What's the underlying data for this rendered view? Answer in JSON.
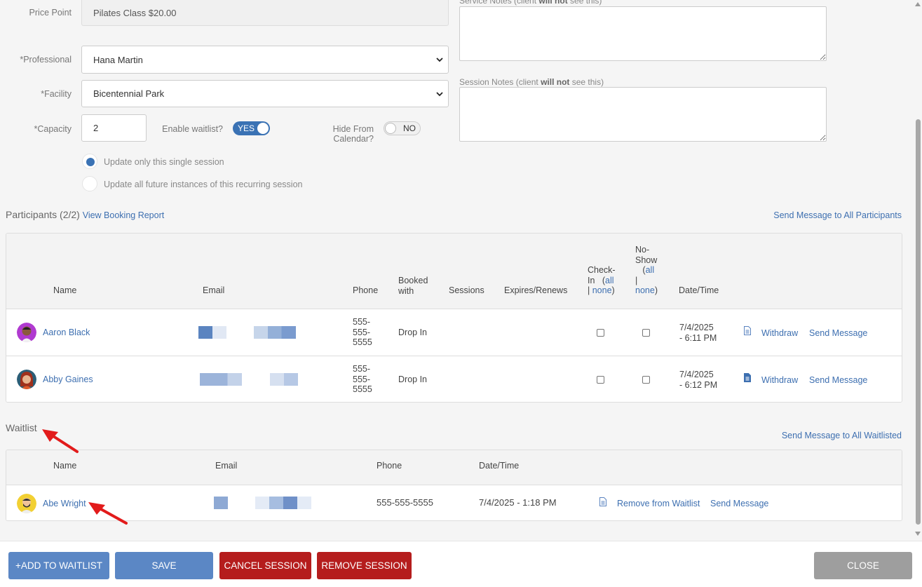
{
  "form": {
    "price_point_label": "Price Point",
    "price_point_value": "Pilates Class $20.00",
    "professional_label": "*Professional",
    "professional_value": "Hana Martin",
    "facility_label": "*Facility",
    "facility_value": "Bicentennial Park",
    "capacity_label": "*Capacity",
    "capacity_value": "2",
    "waitlist_label": "Enable waitlist?",
    "waitlist_toggle": "YES",
    "hide_label_1": "Hide From",
    "hide_label_2": "Calendar?",
    "hide_toggle": "NO",
    "radio_single": "Update only this single session",
    "radio_all": "Update all future instances of this recurring session",
    "service_notes_pre": "Service Notes (client ",
    "service_notes_bold": "will not",
    "service_notes_post": " see this)",
    "session_notes_pre": "Session Notes (client ",
    "session_notes_bold": "will not",
    "session_notes_post": " see this)"
  },
  "participants": {
    "title": "Participants (2/2)",
    "report_link": "View Booking Report",
    "send_all": "Send Message to All Participants",
    "headers": {
      "name": "Name",
      "email": "Email",
      "phone": "Phone",
      "booked_1": "Booked",
      "booked_2": "with",
      "sessions": "Sessions",
      "expires": "Expires/Renews",
      "checkin_1": "Check-",
      "checkin_2": "In",
      "noshow_1": "No-",
      "noshow_2": "Show",
      "all": "all",
      "sep": "|",
      "none": "none",
      "datetime": "Date/Time"
    },
    "rows": [
      {
        "name": "Aaron Black",
        "phone_1": "555-",
        "phone_2": "555-",
        "phone_3": "5555",
        "booked": "Drop In",
        "date_1": "7/4/2025",
        "date_2": "- 6:11 PM",
        "withdraw": "Withdraw",
        "send": "Send Message"
      },
      {
        "name": "Abby Gaines",
        "phone_1": "555-",
        "phone_2": "555-",
        "phone_3": "5555",
        "booked": "Drop In",
        "date_1": "7/4/2025",
        "date_2": "- 6:12 PM",
        "withdraw": "Withdraw",
        "send": "Send Message"
      }
    ]
  },
  "waitlist": {
    "title": "Waitlist",
    "send_all": "Send Message to All Waitlisted",
    "headers": {
      "name": "Name",
      "email": "Email",
      "phone": "Phone",
      "datetime": "Date/Time"
    },
    "rows": [
      {
        "name": "Abe Wright",
        "phone": "555-555-5555",
        "datetime": "7/4/2025 - 1:18 PM",
        "remove": "Remove from Waitlist",
        "send": "Send Message"
      }
    ]
  },
  "footer": {
    "add_waitlist": "+ADD TO WAITLIST",
    "save": "SAVE",
    "cancel_session": "CANCEL SESSION",
    "remove_session": "REMOVE SESSION",
    "close": "CLOSE"
  },
  "colors": {
    "accent": "#3a72b4",
    "link": "#3d6fb0",
    "danger": "#b51d1d",
    "annotation_arrow": "#e21b1b"
  }
}
